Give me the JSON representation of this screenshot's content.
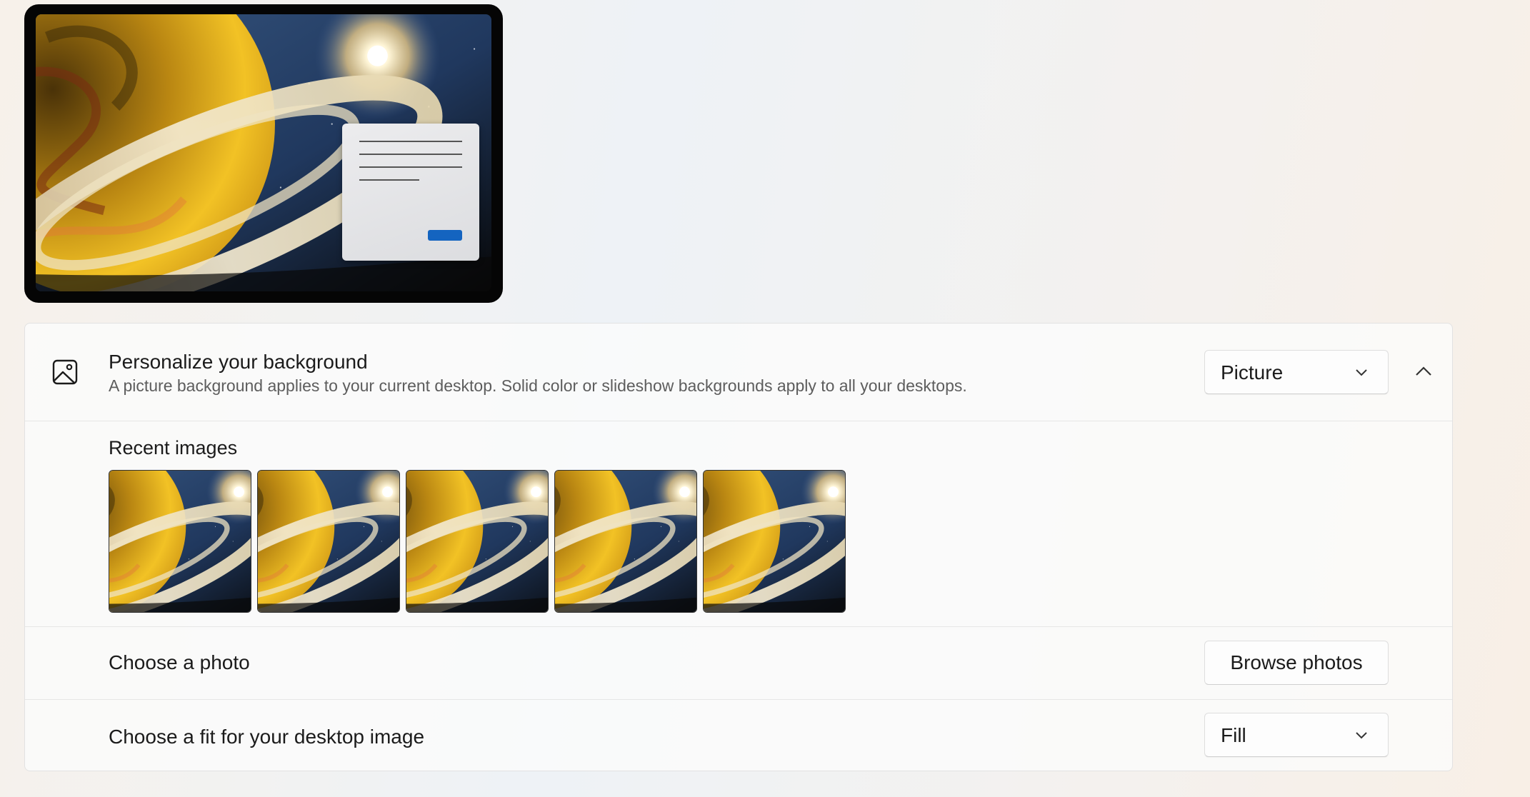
{
  "background": {
    "title": "Personalize your background",
    "description": "A picture background applies to your current desktop. Solid color or slideshow backgrounds apply to all your desktops.",
    "type_selected": "Picture",
    "icon": "picture-icon",
    "collapse_icon": "chevron-up-icon"
  },
  "recent_images": {
    "label": "Recent images",
    "count": 5
  },
  "choose_photo": {
    "label": "Choose a photo",
    "button_label": "Browse photos"
  },
  "fit": {
    "label": "Choose a fit for your desktop image",
    "selected": "Fill"
  },
  "colors": {
    "accent": "#1464c0",
    "card_background": "#fbfbfb"
  }
}
